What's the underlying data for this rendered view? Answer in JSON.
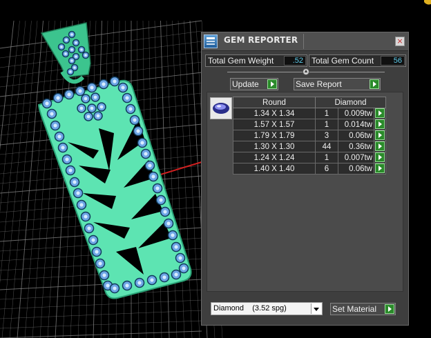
{
  "panel": {
    "title": "GEM REPORTER",
    "close_glyph": "×",
    "total_weight_label": "Total Gem Weight",
    "total_weight_value": ".52",
    "total_count_label": "Total Gem Count",
    "total_count_value": "56",
    "update_label": "Update",
    "save_report_label": "Save Report",
    "table": {
      "headers": [
        "Round",
        "Diamond"
      ],
      "rows": [
        {
          "size": "1.34 X 1.34",
          "count": "1",
          "weight": "0.009tw"
        },
        {
          "size": "1.57 X 1.57",
          "count": "1",
          "weight": "0.014tw"
        },
        {
          "size": "1.79 X 1.79",
          "count": "3",
          "weight": "0.06tw"
        },
        {
          "size": "1.30 X 1.30",
          "count": "44",
          "weight": "0.36tw"
        },
        {
          "size": "1.24 X 1.24",
          "count": "1",
          "weight": "0.007tw"
        },
        {
          "size": "1.40 X 1.40",
          "count": "6",
          "weight": "0.06tw"
        }
      ]
    },
    "material": {
      "selected": "Diamond    (3.52 spg)",
      "set_label": "Set Material"
    }
  },
  "icons": {
    "app": "gem-reporter-app-icon",
    "close": "close-icon",
    "gem": "round-gem-icon",
    "play": "play-arrow-icon",
    "dropdown": "chevron-down-icon"
  },
  "colors": {
    "background": "#000000",
    "grid": "#8c8c8c",
    "pendant": "#5de4b2",
    "gem": "#6ea6e6",
    "panel": "#3e3e3e",
    "value_text": "#5fd0f0",
    "play_button": "#2a8a2a"
  }
}
